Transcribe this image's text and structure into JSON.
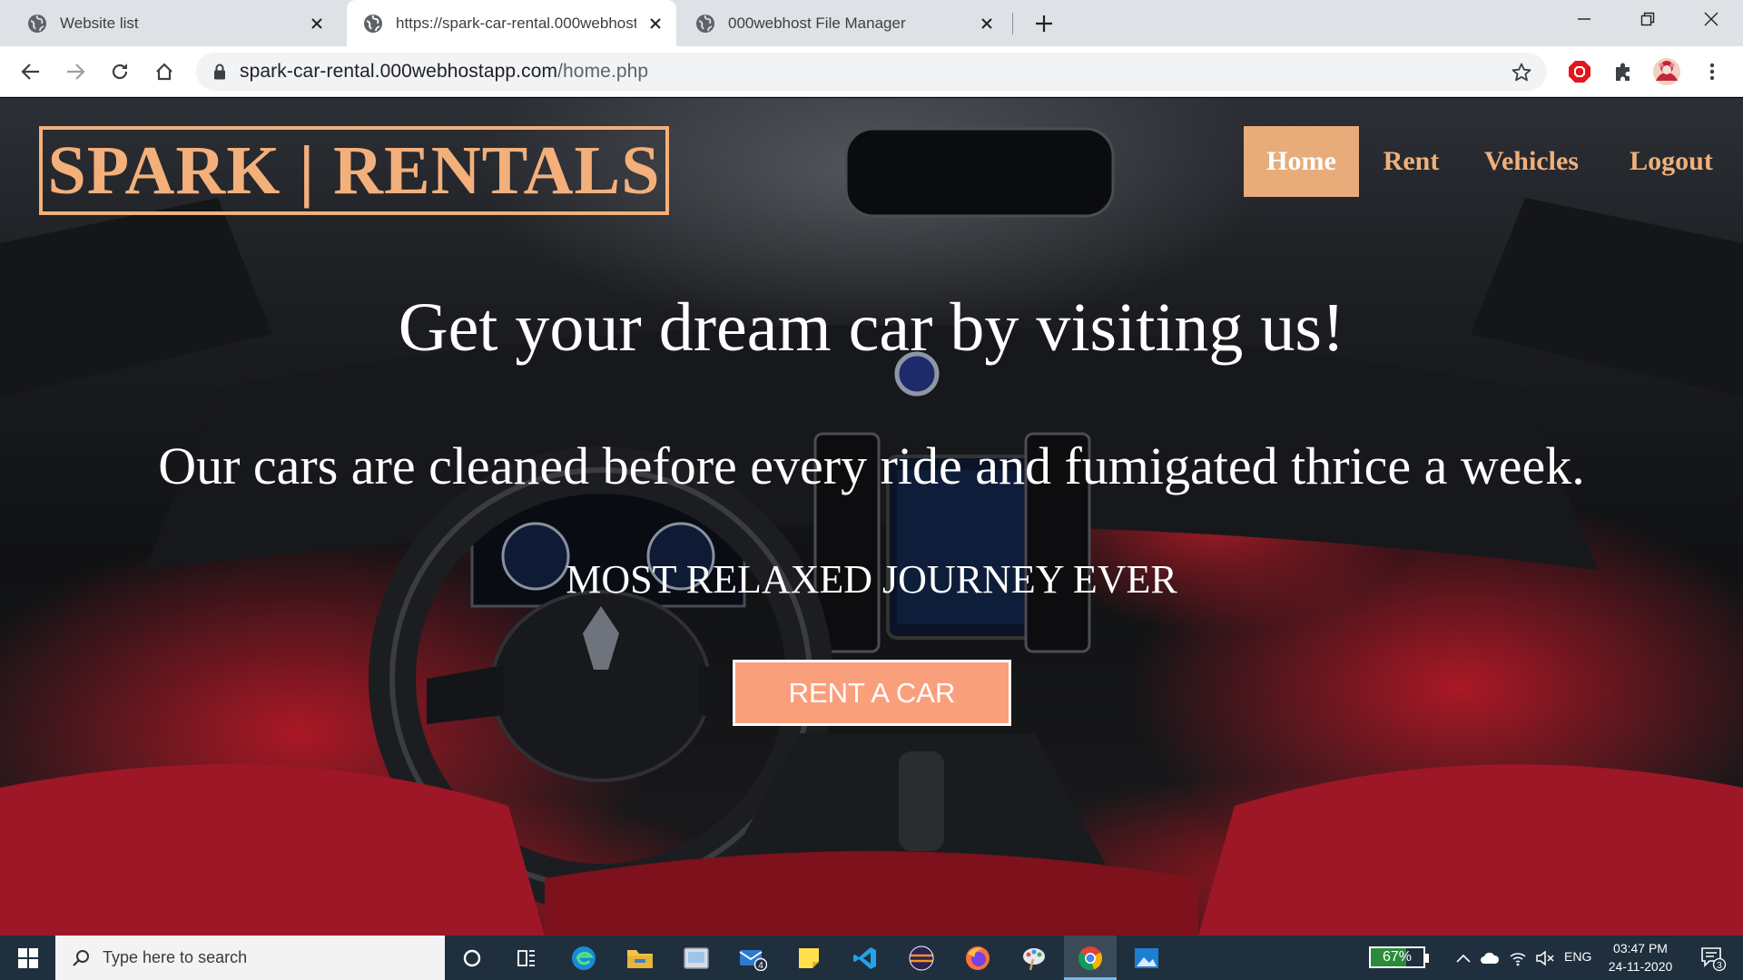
{
  "browser": {
    "tabs": [
      {
        "title": "Website list",
        "active": false
      },
      {
        "title": "https://spark-car-rental.000webhost",
        "active": true
      },
      {
        "title": "000webhost File Manager",
        "active": false
      }
    ],
    "address": {
      "host": "spark-car-rental.000webhostapp.com",
      "path": "/home.php"
    }
  },
  "site": {
    "logo": "SPARK | RENTALS",
    "nav": [
      {
        "label": "Home",
        "active": true
      },
      {
        "label": "Rent",
        "active": false
      },
      {
        "label": "Vehicles",
        "active": false
      },
      {
        "label": "Logout",
        "active": false
      }
    ],
    "headline": "Get your dream car by visiting us!",
    "subline": "Our cars are cleaned before every ride and fumigated thrice a week.",
    "tagline": "MOST RELAXED JOURNEY EVER",
    "cta_label": "RENT A CAR",
    "colors": {
      "accent": "#f3b07a",
      "cta": "#fa9f7c",
      "nav_active": "#e7ac7a"
    }
  },
  "taskbar": {
    "search_placeholder": "Type here to search",
    "mail_badge": "4",
    "battery_percent": 67,
    "battery_label": "67%",
    "language": "ENG",
    "time": "03:47 PM",
    "date": "24-11-2020",
    "notification_count": "3",
    "pinned_icons": [
      "edge-icon",
      "file-explorer-icon",
      "snipping-icon",
      "mail-icon",
      "sticky-notes-icon",
      "vscode-icon",
      "eclipse-icon",
      "firefox-icon",
      "paint-icon",
      "chrome-icon",
      "photos-icon"
    ]
  }
}
